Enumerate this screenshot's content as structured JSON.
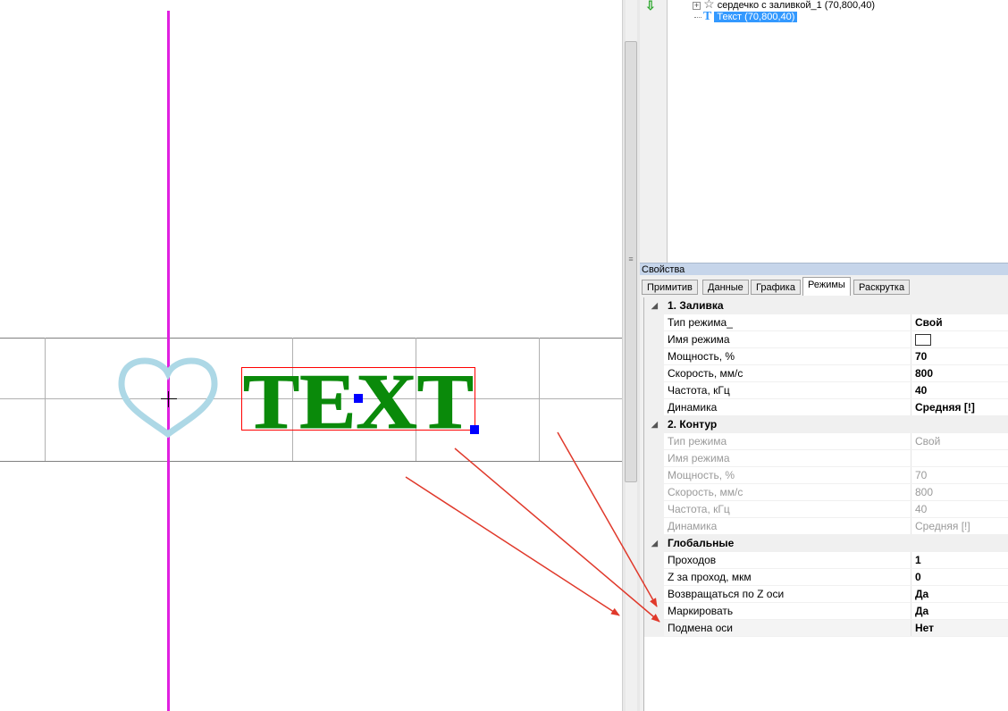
{
  "tree": {
    "items": [
      {
        "label": "сердечко с заливкой_1 (70,800,40)",
        "icon": "star-icon",
        "expander": "+"
      },
      {
        "label": "Текст (70,800,40)",
        "icon": "text-t-icon",
        "selected": true
      }
    ]
  },
  "canvas": {
    "heart_color": "#add8e6",
    "text_color": "#0a8a0a",
    "axis_color": "#e020e0",
    "selection_color": "#ff0000",
    "handle_color": "#0000ff",
    "text_object": "TEXT"
  },
  "properties": {
    "title": "Свойства",
    "tabs": [
      "Примитив",
      "Данные",
      "Графика",
      "Режимы",
      "Раскрутка"
    ],
    "active_tab": "Режимы",
    "categories": [
      {
        "label": "1. Заливка",
        "rows": [
          {
            "name": "Тип режима_",
            "value": "Свой"
          },
          {
            "name": "Имя режима",
            "value": "",
            "swatch": true
          },
          {
            "name": "Мощность, %",
            "value": "70"
          },
          {
            "name": "Скорость, мм/с",
            "value": "800"
          },
          {
            "name": "Частота, кГц",
            "value": "40"
          },
          {
            "name": "Динамика",
            "value": "Средняя [!]"
          }
        ]
      },
      {
        "label": "2. Контур",
        "rows": [
          {
            "name": "Тип режима",
            "value": "Свой",
            "disabled": true
          },
          {
            "name": "Имя режима",
            "value": "",
            "disabled": true
          },
          {
            "name": "Мощность, %",
            "value": "70",
            "disabled": true
          },
          {
            "name": "Скорость, мм/с",
            "value": "800",
            "disabled": true
          },
          {
            "name": "Частота, кГц",
            "value": "40",
            "disabled": true
          },
          {
            "name": "Динамика",
            "value": "Средняя [!]",
            "disabled": true
          }
        ]
      },
      {
        "label": "Глобальные",
        "rows": [
          {
            "name": "Проходов",
            "value": "1"
          },
          {
            "name": "Z за проход, мкм",
            "value": "0"
          },
          {
            "name": "Возвращаться по Z оси",
            "value": "Да"
          },
          {
            "name": "Маркировать",
            "value": "Да"
          },
          {
            "name": "Подмена оси",
            "value": "Нет",
            "highlight": true
          }
        ]
      }
    ]
  },
  "annotation_color": "#e0392b"
}
